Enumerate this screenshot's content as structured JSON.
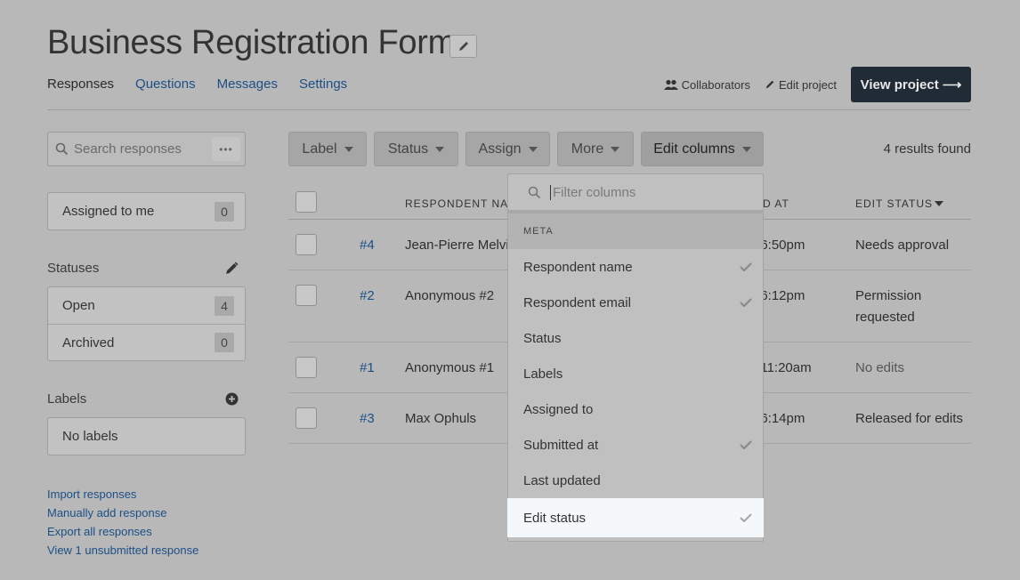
{
  "page": {
    "title": "Business Registration Form",
    "tabs": [
      {
        "label": "Responses",
        "active": true
      },
      {
        "label": "Questions"
      },
      {
        "label": "Messages"
      },
      {
        "label": "Settings"
      }
    ],
    "collaborators_label": "Collaborators",
    "edit_project_label": "Edit project",
    "view_project_label": "View project ⟶"
  },
  "sidebar": {
    "search_placeholder": "Search responses",
    "search_more": "•••",
    "assigned": {
      "label": "Assigned to me",
      "count": "0"
    },
    "statuses_label": "Statuses",
    "statuses": [
      {
        "label": "Open",
        "count": "4"
      },
      {
        "label": "Archived",
        "count": "0"
      }
    ],
    "labels_label": "Labels",
    "no_labels": "No labels",
    "links": [
      "Import responses",
      "Manually add response",
      "Export all responses",
      "View 1 unsubmitted response"
    ]
  },
  "toolbar": {
    "label_btn": "Label",
    "status_btn": "Status",
    "assign_btn": "Assign",
    "more_btn": "More",
    "edit_columns_btn": "Edit columns",
    "results": "4 results found"
  },
  "table": {
    "headers": {
      "respondent": "RESPONDENT NAM",
      "submitted": "D AT",
      "edit_status": "EDIT STATUS"
    },
    "rows": [
      {
        "num": "#4",
        "name": "Jean-Pierre Melvi",
        "time": ": 6:50pm",
        "status_line1": "Needs approval",
        "status_line2": ""
      },
      {
        "num": "#2",
        "name": "Anonymous #2",
        "time": ": 6:12pm",
        "status_line1": "Permission",
        "status_line2": "requested"
      },
      {
        "num": "#1",
        "name": "Anonymous #1",
        "time": ": 11:20am",
        "status_line1": "No edits",
        "status_line2": ""
      },
      {
        "num": "#3",
        "name": "Max Ophuls",
        "time": ": 6:14pm",
        "status_line1": "Released for edits",
        "status_line2": ""
      }
    ]
  },
  "dropdown": {
    "filter_placeholder": "Filter columns",
    "section": "META",
    "options": [
      {
        "label": "Respondent name",
        "checked": true
      },
      {
        "label": "Respondent email",
        "checked": true
      },
      {
        "label": "Status",
        "checked": false
      },
      {
        "label": "Labels",
        "checked": false
      },
      {
        "label": "Assigned to",
        "checked": false
      },
      {
        "label": "Submitted at",
        "checked": true
      },
      {
        "label": "Last updated",
        "checked": false
      },
      {
        "label": "Edit status",
        "checked": true
      }
    ]
  },
  "colors": {
    "link": "#1c4f86",
    "primary_button": "#202b36",
    "overlay": "#b8b8b8",
    "highlight": "#f4f8fb"
  }
}
